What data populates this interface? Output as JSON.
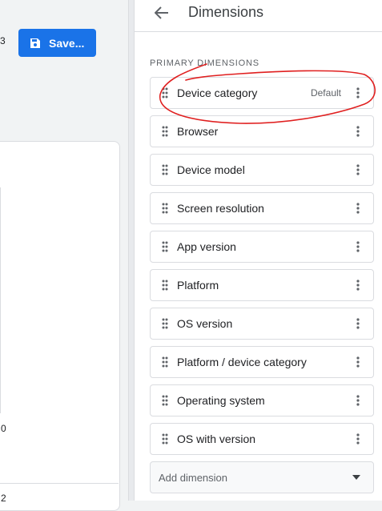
{
  "left": {
    "fragment_top": "3",
    "fragment_axis_mid": "0",
    "fragment_axis_bottom": "2"
  },
  "toolbar": {
    "save_label": "Save..."
  },
  "panel": {
    "title": "Dimensions",
    "section_label": "PRIMARY DIMENSIONS",
    "items": [
      {
        "label": "Device category",
        "badge": "Default"
      },
      {
        "label": "Browser"
      },
      {
        "label": "Device model"
      },
      {
        "label": "Screen resolution"
      },
      {
        "label": "App version"
      },
      {
        "label": "Platform"
      },
      {
        "label": "OS version"
      },
      {
        "label": "Platform / device category"
      },
      {
        "label": "Operating system"
      },
      {
        "label": "OS with version"
      }
    ],
    "add_dimension_placeholder": "Add dimension"
  },
  "colors": {
    "accent": "#1a73e8",
    "annotation": "#e02020"
  }
}
